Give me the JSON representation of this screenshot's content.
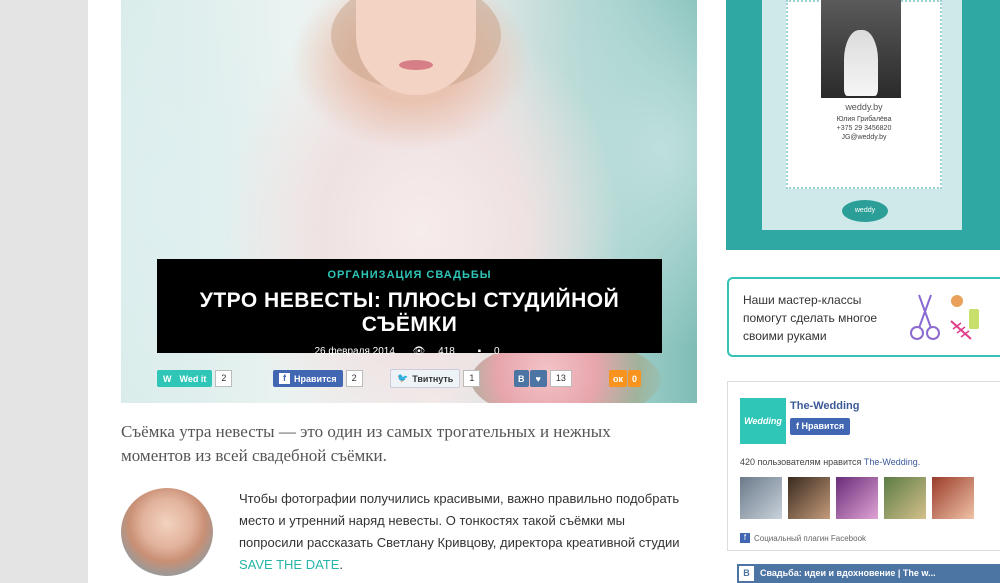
{
  "article": {
    "category": "ОРГАНИЗАЦИЯ СВАДЬБЫ",
    "title": "УТРО НЕВЕСТЫ: ПЛЮСЫ СТУДИЙНОЙ СЪЁМКИ",
    "date": "26 февраля 2014",
    "views": "418",
    "comments": "0",
    "lead": "Съёмка утра невесты — это один из самых трогательных и нежных моментов из всей свадебной съёмки.",
    "paragraph": "Чтобы фотографии получились красивыми, важно правильно подобрать место и утренний наряд невесты. О тонкостях такой съёмки мы попросили рассказать Светлану Кривцову, директора креативной студии",
    "paragraph_link": "SAVE THE DATE",
    "paragraph_end": "."
  },
  "share": {
    "wedit": {
      "label": "Wed it",
      "count": "2"
    },
    "facebook": {
      "label": "Нравится",
      "count": "2"
    },
    "twitter": {
      "label": "Твитнуть",
      "count": "1"
    },
    "vk": {
      "count": "13"
    },
    "ok": {
      "count": "0"
    }
  },
  "ad": {
    "site": "weddy.by",
    "name": "Юлия Грибалёва",
    "phone": "+375 29 3456820",
    "email": "JG@weddy.by"
  },
  "master_classes": {
    "text_line1": "Наши мастер-классы",
    "text_line2": "помогут сделать многое",
    "text_line3": "своими руками"
  },
  "facebook_widget": {
    "page_name": "The-Wedding",
    "logo_text": "Wedding",
    "like_label": "Нравится",
    "count_text": "420 пользователям нравится",
    "count_link": "The-Wedding.",
    "plugin_text": "Социальный плагин Facebook"
  },
  "vk_widget": {
    "title": "Свадьба: идеи и вдохновение | The w..."
  },
  "colors": {
    "accent": "#2fc6b8",
    "ad_bg": "#2fa8a3",
    "facebook": "#4267b2",
    "vk": "#4c75a3"
  }
}
